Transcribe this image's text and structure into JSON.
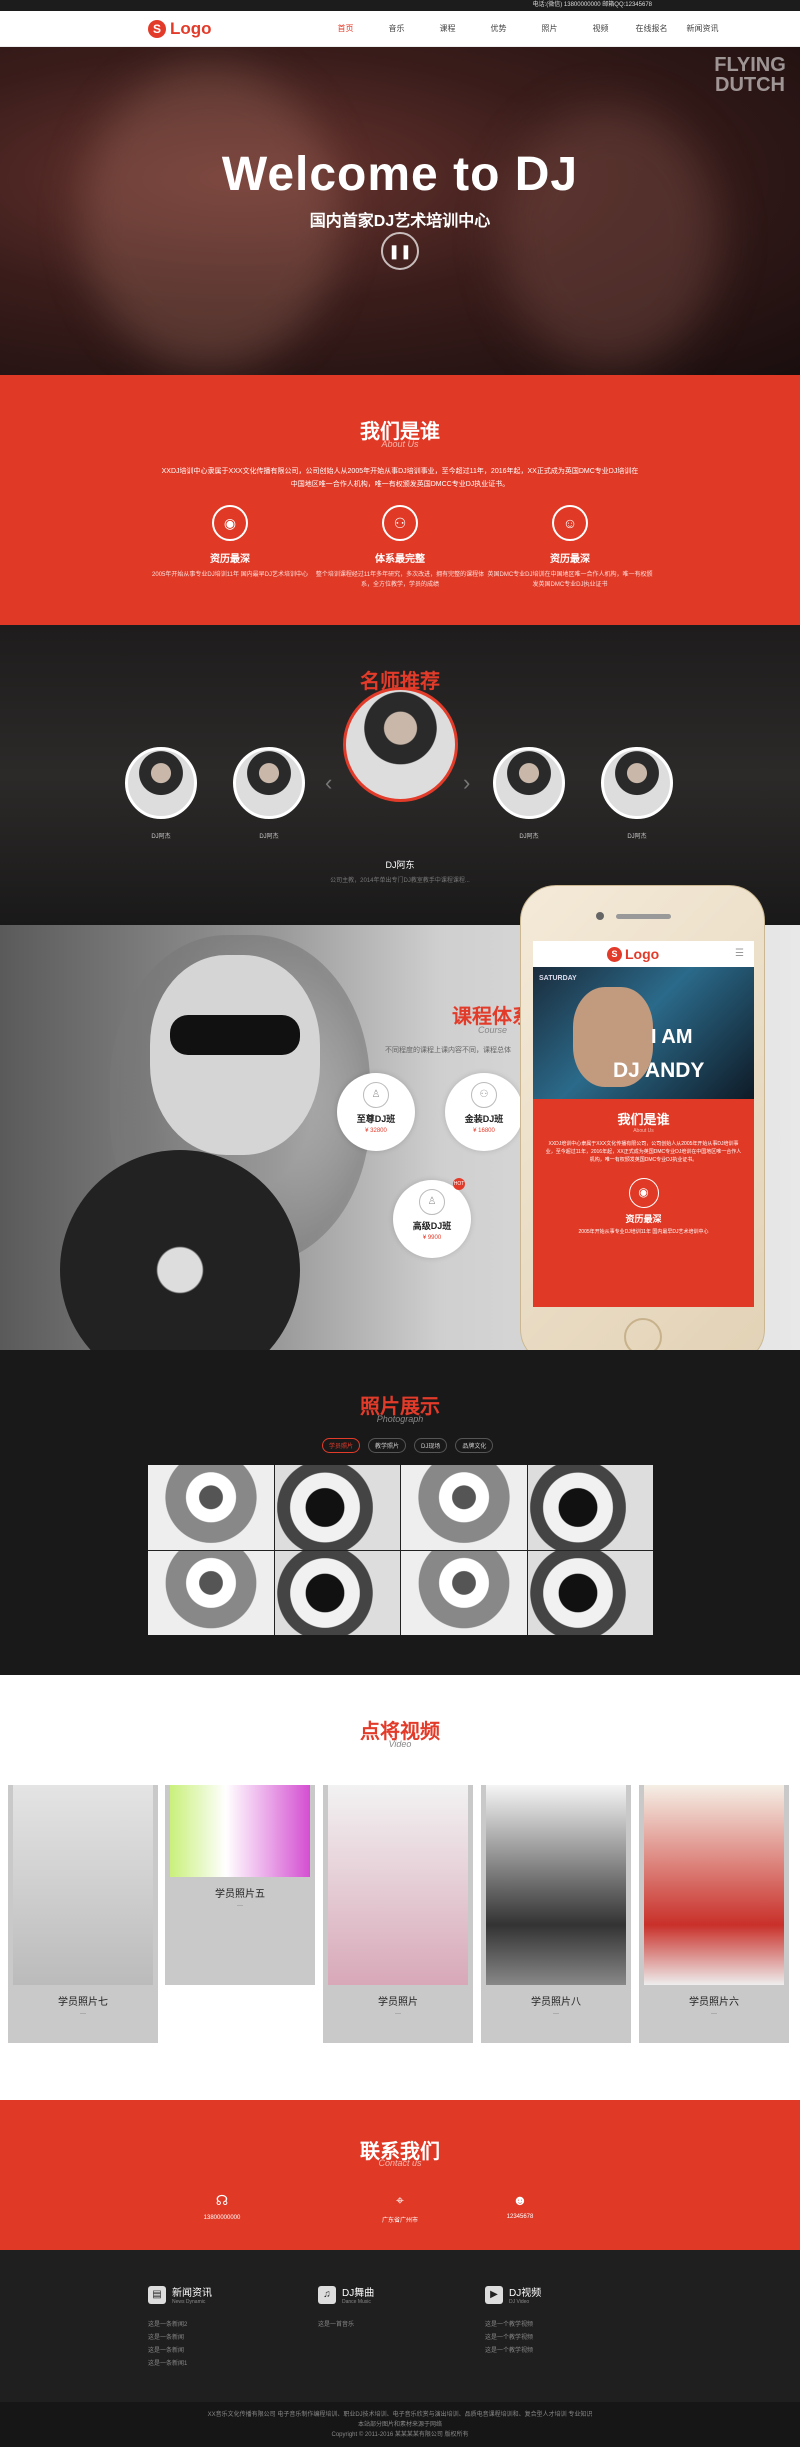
{
  "topbar": {
    "text": "电话:(微信) 13800000000 邮箱QQ:12345678"
  },
  "nav": {
    "logo": "Logo",
    "items": [
      "首页",
      "音乐",
      "课程",
      "优势",
      "照片",
      "视频",
      "在线报名",
      "新闻资讯"
    ],
    "active": 0
  },
  "hero": {
    "title": "Welcome to DJ",
    "subtitle": "国内首家DJ艺术培训中心",
    "deco": "FLYING DUTCH"
  },
  "about": {
    "title": "我们是谁",
    "subtitle": "About Us",
    "desc": "XXDJ培训中心隶属于XXX文化传播有限公司，公司创始人从2005年开始从事DJ培训事业，至今超过11年，2016年起，XX正式成为英国DMC专业DJ培训在中国地区唯一合作人机构，唯一有权颁发英国DMCC专业DJ执业证书。",
    "features": [
      {
        "icon": "radio-icon",
        "title": "资历最深",
        "desc": "2005年开始从事专业DJ培训11年 国内最早DJ艺术培训中心"
      },
      {
        "icon": "network-icon",
        "title": "体系最完整",
        "desc": "整个培训课程经过11年多年研究，多次改进，拥有完整的课程体系，全方位教学，学员的成绩"
      },
      {
        "icon": "person-icon",
        "title": "资历最深",
        "desc": "英国DMC专业DJ培训在中国地区唯一合作人机构，唯一有权颁发英国DMC专业DJ执业证书"
      }
    ]
  },
  "teachers": {
    "title": "名师推荐",
    "subtitle": "Teacher",
    "list": [
      "DJ阿杰",
      "DJ阿杰",
      "DJ阿东",
      "DJ阿杰",
      "DJ阿杰"
    ],
    "main_name": "DJ阿东",
    "main_desc": "公司主教，2014年单出专门DJ教室教手中课程课程..."
  },
  "course": {
    "title": "课程体系",
    "subtitle": "Course",
    "desc": "不同程度的课程上课内容不同，课程总体",
    "items": [
      {
        "name": "至尊DJ班",
        "price": "¥ 32800",
        "icon": "user-icon"
      },
      {
        "name": "金装DJ班",
        "price": "¥ 16800",
        "icon": "network-icon"
      },
      {
        "name": "高级DJ班",
        "price": "¥ 9900",
        "icon": "user-icon",
        "badge": "HOT"
      }
    ]
  },
  "phone": {
    "logo": "Logo",
    "banner_top": "SATURDAY",
    "iam": "I AM",
    "dj": "DJ ANDY",
    "about_title": "我们是谁",
    "about_sub": "About Us",
    "about_desc": "XXDJ培训中心隶属于XXX文化传播有限公司，公司创始人从2005年开始从事DJ培训事业，至今超过11年，2016年起，XX正式成为英国DMC专业DJ培训在中国地区唯一合作人机构，唯一有权颁发英国DMC专业DJ执业证书。",
    "feat_title": "资历最深",
    "feat_desc": "2005年开始从事专业DJ培训11年 国内最早DJ艺术培训中心"
  },
  "photos": {
    "title": "照片展示",
    "subtitle": "Photograph",
    "tabs": [
      "学员照片",
      "教学照片",
      "DJ现场",
      "品牌文化"
    ],
    "active": 0
  },
  "video": {
    "title": "点将视频",
    "subtitle": "Video",
    "cards": [
      {
        "caption": "学员照片七",
        "dash": "—"
      },
      {
        "caption": "学员照片五",
        "dash": "—"
      },
      {
        "caption": "学员照片",
        "dash": "—"
      },
      {
        "caption": "学员照片八",
        "dash": "—"
      },
      {
        "caption": "学员照片六",
        "dash": "—"
      }
    ]
  },
  "contact": {
    "title": "联系我们",
    "subtitle": "Contact us",
    "items": [
      {
        "icon": "headset-icon",
        "value": "13800000000"
      },
      {
        "icon": "location-icon",
        "value": "广东省广州市"
      },
      {
        "icon": "qq-icon",
        "value": "12345678"
      }
    ]
  },
  "footer": {
    "cols": [
      {
        "title": "新闻资讯",
        "en": "News Dynamic",
        "items": [
          "这是一条新闻2",
          "这是一条新闻",
          "这是一条新闻",
          "这是一条新闻1"
        ]
      },
      {
        "title": "DJ舞曲",
        "en": "Dance Music",
        "items": [
          "这是一首音乐"
        ]
      },
      {
        "title": "DJ视频",
        "en": "DJ Video",
        "items": [
          "这是一个教学视频",
          "这是一个教学视频",
          "这是一个教学视频"
        ]
      }
    ],
    "copy1": "XX音乐文化传播有限公司 电子音乐制作编程培训、职业DJ技术培训、电子音乐欣赏与演出培训、品质电音课程培训和、复合型人才培训 专业知识",
    "copy2": "本站部分图片和素材来源于网络",
    "copy3": "Copyright © 2011-2016 某某某某有限公司 版权所有"
  }
}
